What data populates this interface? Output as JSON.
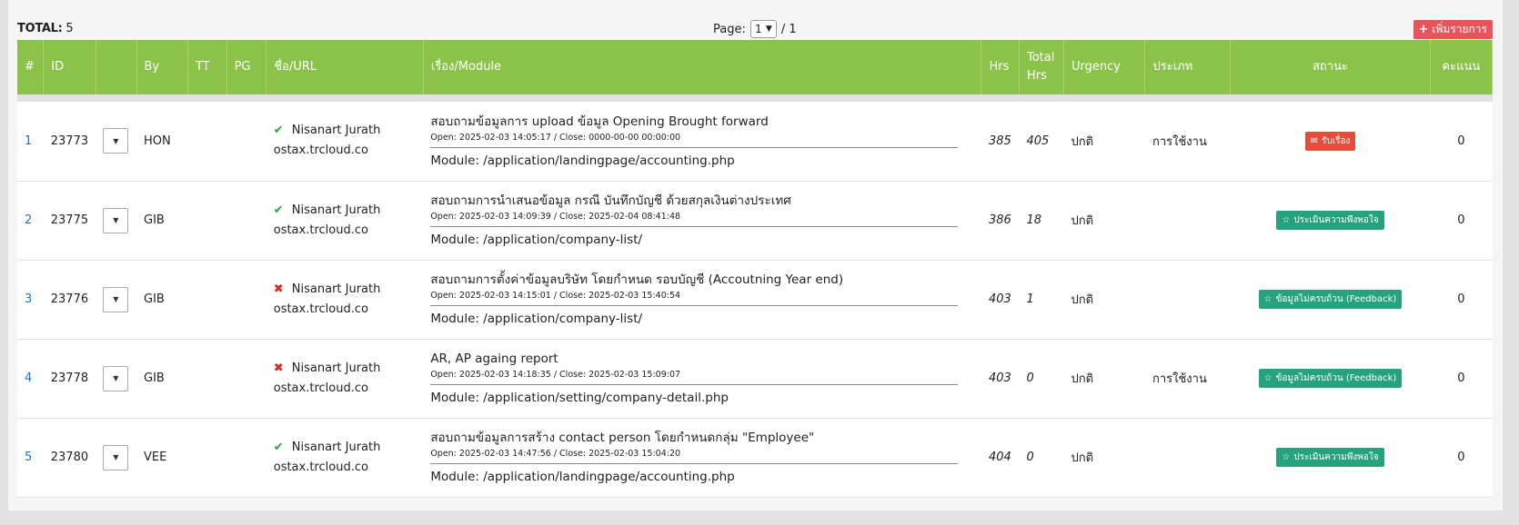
{
  "toolbar": {
    "total_label": "TOTAL:",
    "total_value": "5",
    "page_label": "Page:",
    "page_current": "1",
    "page_sep": "/ 1",
    "add_label": "เพิ่มรายการ"
  },
  "columns": [
    "#",
    "ID",
    "",
    "By",
    "TT",
    "PG",
    "ชื่อ/URL",
    "เรื่อง/Module",
    "Hrs",
    "Total Hrs",
    "Urgency",
    "ประเภท",
    "สถานะ",
    "คะแนน"
  ],
  "colors": {
    "header": "#8bc34a",
    "ok": "#2e9f3a",
    "no": "#e0261c",
    "badge_red": "#e44d3a",
    "badge_green": "#26a37e",
    "link": "#1e73be"
  },
  "rows": [
    {
      "no": "1",
      "id": "23773",
      "by": "HON",
      "tt": "",
      "pg": "",
      "check": "ok",
      "name": "Nisanart Jurath",
      "url": "ostax.trcloud.co",
      "subject": "สอบถามข้อมูลการ upload ข้อมูล Opening Brought forward",
      "times": "Open: 2025-02-03 14:05:17 / Close: 0000-00-00 00:00:00",
      "module": "Module: /application/landingpage/accounting.php",
      "hrs": "385",
      "total_hrs": "405",
      "urgency": "ปกติ",
      "type": "การใช้งาน",
      "status": "รับเรื่อง",
      "status_color": "red",
      "status_icon": "envelope-icon",
      "score": "0"
    },
    {
      "no": "2",
      "id": "23775",
      "by": "GIB",
      "tt": "",
      "pg": "",
      "check": "ok",
      "name": "Nisanart Jurath",
      "url": "ostax.trcloud.co",
      "subject": "สอบถามการนำเสนอข้อมูล กรณี บันทึกบัญชี ด้วยสกุลเงินต่างประเทศ",
      "times": "Open: 2025-02-03 14:09:39 / Close: 2025-02-04 08:41:48",
      "module": "Module: /application/company-list/",
      "hrs": "386",
      "total_hrs": "18",
      "urgency": "ปกติ",
      "type": "",
      "status": "ประเมินความพึงพอใจ",
      "status_color": "green",
      "status_icon": "star-icon",
      "score": "0"
    },
    {
      "no": "3",
      "id": "23776",
      "by": "GIB",
      "tt": "",
      "pg": "",
      "check": "no",
      "name": "Nisanart Jurath",
      "url": "ostax.trcloud.co",
      "subject": "สอบถามการตั้งค่าข้อมูลบริษัท โดยกำหนด รอบบัญชี (Accoutning Year end)",
      "times": "Open: 2025-02-03 14:15:01 / Close: 2025-02-03 15:40:54",
      "module": "Module: /application/company-list/",
      "hrs": "403",
      "total_hrs": "1",
      "urgency": "ปกติ",
      "type": "",
      "status": "ข้อมูลไม่ครบถ้วน (Feedback)",
      "status_color": "green",
      "status_icon": "star-icon",
      "score": "0"
    },
    {
      "no": "4",
      "id": "23778",
      "by": "GIB",
      "tt": "",
      "pg": "",
      "check": "no",
      "name": "Nisanart Jurath",
      "url": "ostax.trcloud.co",
      "subject": "AR, AP againg report",
      "times": "Open: 2025-02-03 14:18:35 / Close: 2025-02-03 15:09:07",
      "module": "Module: /application/setting/company-detail.php",
      "hrs": "403",
      "total_hrs": "0",
      "urgency": "ปกติ",
      "type": "การใช้งาน",
      "status": "ข้อมูลไม่ครบถ้วน (Feedback)",
      "status_color": "green",
      "status_icon": "star-icon",
      "score": "0"
    },
    {
      "no": "5",
      "id": "23780",
      "by": "VEE",
      "tt": "",
      "pg": "",
      "check": "ok",
      "name": "Nisanart Jurath",
      "url": "ostax.trcloud.co",
      "subject": "สอบถามข้อมูลการสร้าง contact person โดยกำหนดกลุ่ม \"Employee\"",
      "times": "Open: 2025-02-03 14:47:56 / Close: 2025-02-03 15:04:20",
      "module": "Module: /application/landingpage/accounting.php",
      "hrs": "404",
      "total_hrs": "0",
      "urgency": "ปกติ",
      "type": "",
      "status": "ประเมินความพึงพอใจ",
      "status_color": "green",
      "status_icon": "star-icon",
      "score": "0"
    }
  ]
}
